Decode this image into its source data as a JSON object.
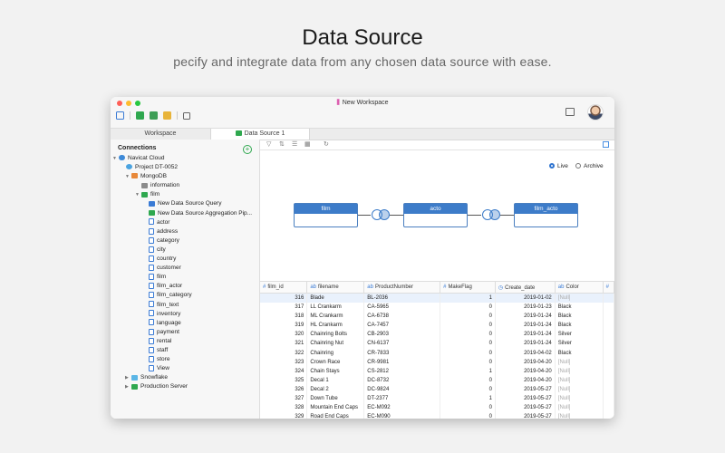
{
  "headline": "Data Source",
  "subline": "pecify and integrate data from any chosen data source with ease.",
  "window": {
    "title": "New Workspace",
    "tabs": [
      {
        "label": "Workspace"
      },
      {
        "label": "Data Source 1"
      }
    ]
  },
  "sidebar": {
    "header": "Connections",
    "tree": [
      {
        "label": "Navicat Cloud"
      },
      {
        "label": "Project DT-0052"
      },
      {
        "label": "MongoDB"
      },
      {
        "label": "information"
      },
      {
        "label": "film"
      },
      {
        "label": "New Data Source Query"
      },
      {
        "label": "New Data Source Aggregation Pip..."
      },
      {
        "label": "actor"
      },
      {
        "label": "address"
      },
      {
        "label": "category"
      },
      {
        "label": "city"
      },
      {
        "label": "country"
      },
      {
        "label": "customer"
      },
      {
        "label": "film"
      },
      {
        "label": "film_actor"
      },
      {
        "label": "film_category"
      },
      {
        "label": "film_text"
      },
      {
        "label": "inventory"
      },
      {
        "label": "language"
      },
      {
        "label": "payment"
      },
      {
        "label": "rental"
      },
      {
        "label": "staff"
      },
      {
        "label": "store"
      },
      {
        "label": "View"
      },
      {
        "label": "Snowflake"
      },
      {
        "label": "Production Server"
      }
    ]
  },
  "canvas": {
    "live_label": "Live",
    "archive_label": "Archive",
    "selected": "Live",
    "nodes": [
      "film",
      "acto",
      "film_acto"
    ]
  },
  "grid": {
    "columns": [
      "film_id",
      "filename",
      "ProductNumber",
      "MakeFlag",
      "Create_date",
      "Color"
    ],
    "rows": [
      [
        "316",
        "Blade",
        "BL-2036",
        "1",
        "2019-01-02",
        "[Null]"
      ],
      [
        "317",
        "LL Crankarm",
        "CA-5965",
        "0",
        "2019-01-23",
        "Black"
      ],
      [
        "318",
        "ML Crankarm",
        "CA-6738",
        "0",
        "2019-01-24",
        "Black"
      ],
      [
        "319",
        "HL Crankarm",
        "CA-7457",
        "0",
        "2019-01-24",
        "Black"
      ],
      [
        "320",
        "Chainring Bolts",
        "CB-2903",
        "0",
        "2019-01-24",
        "Silver"
      ],
      [
        "321",
        "Chainring Nut",
        "CN-6137",
        "0",
        "2019-01-24",
        "Silver"
      ],
      [
        "322",
        "Chainring",
        "CR-7833",
        "0",
        "2019-04-02",
        "Black"
      ],
      [
        "323",
        "Crown Race",
        "CR-9981",
        "0",
        "2019-04-20",
        "[Null]"
      ],
      [
        "324",
        "Chain Stays",
        "CS-2812",
        "1",
        "2019-04-20",
        "[Null]"
      ],
      [
        "325",
        "Decal 1",
        "DC-8732",
        "0",
        "2019-04-20",
        "[Null]"
      ],
      [
        "326",
        "Decal 2",
        "DC-9824",
        "0",
        "2019-05-27",
        "[Null]"
      ],
      [
        "327",
        "Down Tube",
        "DT-2377",
        "1",
        "2019-05-27",
        "[Null]"
      ],
      [
        "328",
        "Mountain End Caps",
        "EC-M092",
        "0",
        "2019-05-27",
        "[Null]"
      ],
      [
        "329",
        "Road End Caps",
        "EC-M090",
        "0",
        "2019-05-27",
        "[Null]"
      ]
    ]
  }
}
